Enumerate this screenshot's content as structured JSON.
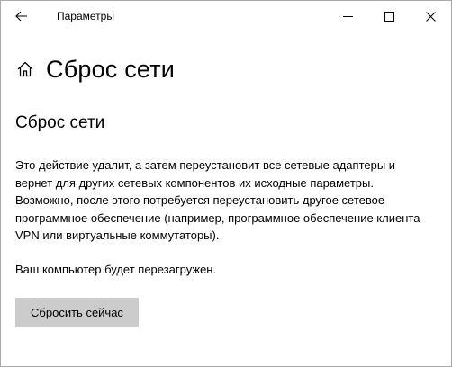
{
  "window": {
    "title": "Параметры"
  },
  "header": {
    "title": "Сброс сети"
  },
  "section": {
    "title": "Сброс сети",
    "description": "Это действие удалит, а затем переустановит все сетевые адаптеры и вернет для других сетевых компонентов их исходные параметры. Возможно, после этого потребуется переустановить другое сетевое программное обеспечение (например, программное обеспечение клиента VPN или виртуальные коммутаторы).",
    "restart_note": "Ваш компьютер будет перезагружен.",
    "reset_button_label": "Сбросить сейчас"
  },
  "icons": {
    "back": "back-arrow-icon",
    "minimize": "minimize-icon",
    "maximize": "maximize-icon",
    "close": "close-icon",
    "home": "home-icon"
  },
  "colors": {
    "button_background": "#cccccc",
    "window_border": "#aaaaaa",
    "text": "#000000"
  }
}
